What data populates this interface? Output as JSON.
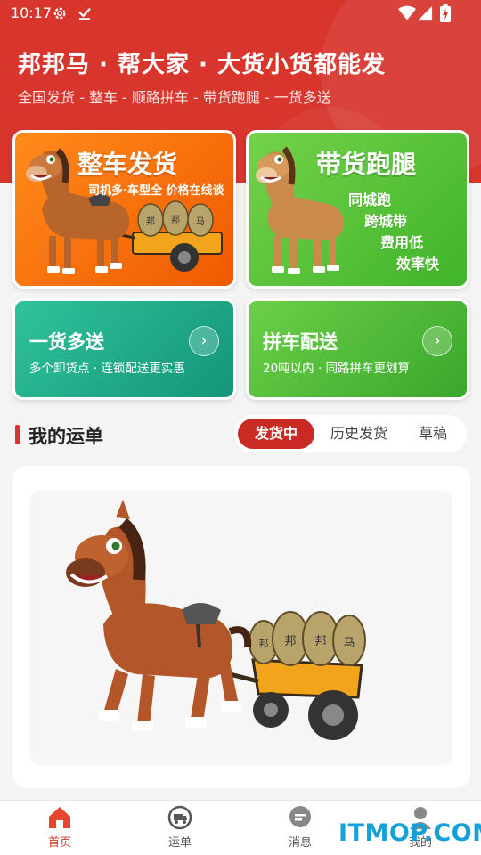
{
  "status_bar": {
    "time": "10:17",
    "icons": [
      "gear-icon",
      "download-done-icon",
      "wifi-icon",
      "signal-icon",
      "battery-charging-icon"
    ]
  },
  "header": {
    "slogan": "邦邦马 · 帮大家 · 大货小货都能发",
    "sub_slogan": "全国发货 - 整车 - 顺路拼车 - 带货跑腿 - 一货多送",
    "color": "#d8352d"
  },
  "feature_cards": {
    "full_truck": {
      "title": "整车发货",
      "subtitle": "司机多·车型全 价格在线谈",
      "cargo_bags": [
        "邦",
        "邦",
        "马"
      ],
      "color": "#f26a08"
    },
    "errand": {
      "title": "带货跑腿",
      "lines": [
        "同城跑",
        "跨城带",
        "费用低",
        "效率快"
      ],
      "color": "#4fbe33"
    },
    "multi_drop": {
      "title": "一货多送",
      "subtitle": "多个卸货点 · 连锁配送更实惠",
      "arrow": "›",
      "color": "#1aa07f"
    },
    "carpool": {
      "title": "拼车配送",
      "subtitle": "20吨以内 · 同路拼车更划算",
      "arrow": "›",
      "color": "#4db935"
    }
  },
  "orders_section": {
    "title": "我的运单",
    "tabs": [
      {
        "label": "发货中",
        "active": true
      },
      {
        "label": "历史发货",
        "active": false
      },
      {
        "label": "草稿",
        "active": false
      }
    ],
    "empty_cargo_bags": [
      "邦",
      "邦",
      "邦",
      "马"
    ]
  },
  "bottom_nav": [
    {
      "label": "首页",
      "icon": "home-icon",
      "active": true
    },
    {
      "label": "运单",
      "icon": "truck-order-icon",
      "active": false
    },
    {
      "label": "消息",
      "icon": "message-icon",
      "active": false
    },
    {
      "label": "我的",
      "icon": "person-icon",
      "active": false
    }
  ],
  "watermark": "ITMOP.COM"
}
